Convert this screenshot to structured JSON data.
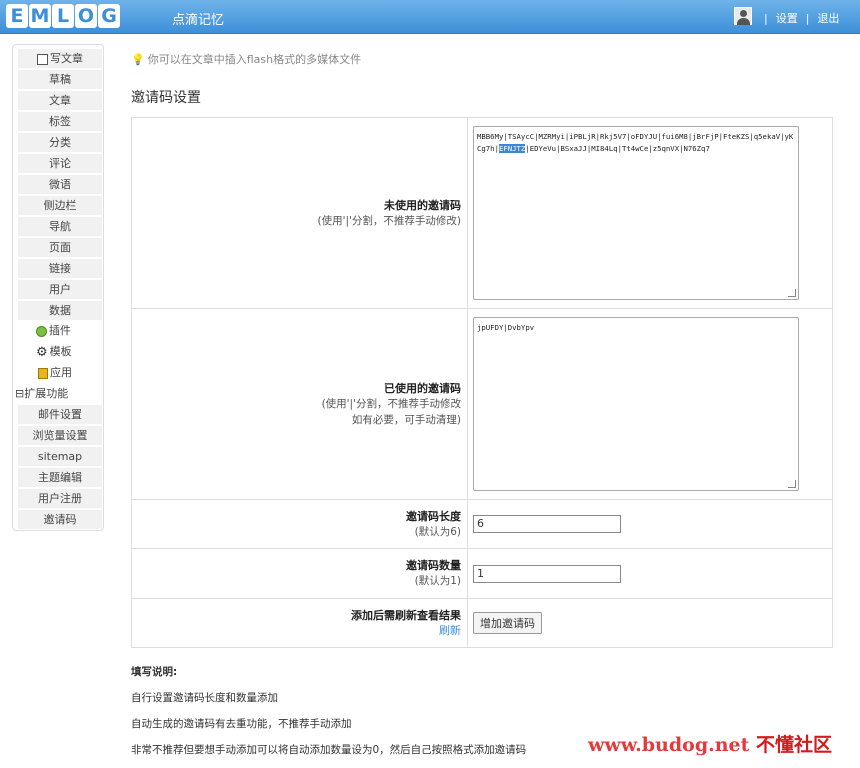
{
  "header": {
    "logo_letters": [
      "E",
      "M",
      "L",
      "O",
      "G"
    ],
    "blog_name": "点滴记忆",
    "links": [
      "设置",
      "退出"
    ],
    "separator": "|"
  },
  "sidebar": {
    "write_article": "写文章",
    "items": [
      "草稿",
      "文章",
      "标签",
      "分类",
      "评论",
      "微语",
      "侧边栏",
      "导航",
      "页面",
      "链接",
      "用户",
      "数据"
    ],
    "plugins": "插件",
    "templates": "模板",
    "apps": "应用",
    "extensions_header": "⊟扩展功能",
    "ext_items": [
      "邮件设置",
      "浏览量设置",
      "sitemap",
      "主题编辑",
      "用户注册",
      "邀请码"
    ]
  },
  "main": {
    "hint": "你可以在文章中插入flash格式的多媒体文件",
    "page_title": "邀请码设置",
    "unused": {
      "label": "未使用的邀请码",
      "sub": "(使用'|'分割，不推荐手动修改)",
      "codes_before": "MBB6My|TSAycC|MZRMyi|iPBLjR|Rkj5V7|oFDYJU|fui6M8|jBrFjP|FteKZS|q5ekaV|yKCg7h|",
      "codes_selected": "EFNJTZ",
      "codes_after": "|EDYeVu|BSxaJJ|MI84Lq|Tt4wCe|z5qnVX|N76Zq7"
    },
    "used": {
      "label": "已使用的邀请码",
      "sub1": "(使用'|'分割，不推荐手动修改",
      "sub2": "如有必要，可手动清理)",
      "codes": "jpUFDY|DvbYpv"
    },
    "length": {
      "label": "邀请码长度",
      "sub": "(默认为6)",
      "value": "6"
    },
    "count": {
      "label": "邀请码数量",
      "sub": "(默认为1)",
      "value": "1"
    },
    "add": {
      "label": "添加后需刷新查看结果",
      "refresh": "刷新",
      "button": "增加邀请码"
    },
    "notes": {
      "title": "填写说明:",
      "lines": [
        "自行设置邀请码长度和数量添加",
        "自动生成的邀请码有去重功能，不推荐手动添加",
        "非常不推荐但要想手动添加可以将自动添加数量设为0，然后自己按照格式添加邀请码"
      ]
    }
  },
  "watermark": {
    "url": "www.budog.net",
    "cn": "不懂社区"
  },
  "colors": {
    "header": "#3d8fd8",
    "selection": "#3a87d8",
    "link": "#3d8fd8",
    "watermark": "#e53a3a"
  }
}
